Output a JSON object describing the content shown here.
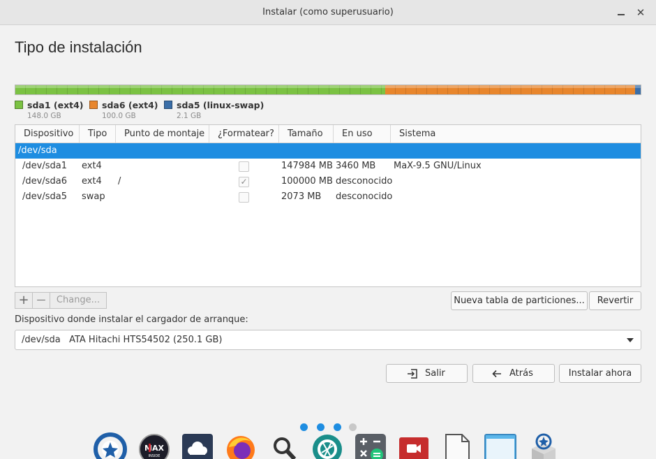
{
  "window": {
    "title": "Instalar (como superusuario)"
  },
  "page": {
    "title": "Tipo de instalación"
  },
  "partitions_bar": [
    {
      "name": "sda1 (ext4)",
      "size": "148.0 GB",
      "color": "#7bc243",
      "fraction": 0.5916
    },
    {
      "name": "sda6 (ext4)",
      "size": "100.0 GB",
      "color": "#e8862d",
      "fraction": 0.3997
    },
    {
      "name": "sda5 (linux-swap)",
      "size": "2.1 GB",
      "color": "#3a6ea8",
      "fraction": 0.0087
    }
  ],
  "table": {
    "columns": [
      "Dispositivo",
      "Tipo",
      "Punto de montaje",
      "¿Formatear?",
      "Tamaño",
      "En uso",
      "Sistema"
    ],
    "rows": [
      {
        "device": "/dev/sda",
        "type": "",
        "mount": "",
        "format": null,
        "size": "",
        "used": "",
        "system": "",
        "selected": true
      },
      {
        "device": "/dev/sda1",
        "type": "ext4",
        "mount": "",
        "format": false,
        "size": "147984 MB",
        "used": "3460 MB",
        "system": "MaX-9.5 GNU/Linux",
        "selected": false
      },
      {
        "device": "/dev/sda6",
        "type": "ext4",
        "mount": "/",
        "format": true,
        "size": "100000 MB",
        "used": "desconocido",
        "system": "",
        "selected": false
      },
      {
        "device": "/dev/sda5",
        "type": "swap",
        "mount": "",
        "format": false,
        "size": "2073 MB",
        "used": "desconocido",
        "system": "",
        "selected": false
      }
    ]
  },
  "toolbar": {
    "add": "+",
    "remove": "—",
    "change": "Change..."
  },
  "actions": {
    "new_table": "Nueva tabla de particiones...",
    "revert": "Revertir"
  },
  "bootloader": {
    "label": "Dispositivo donde instalar el cargador de arranque:",
    "value": "/dev/sda   ATA Hitachi HTS54502 (250.1 GB)"
  },
  "nav": {
    "quit": "Salir",
    "back": "Atrás",
    "install": "Instalar ahora"
  },
  "progress_dots": {
    "total": 4,
    "active": 3
  },
  "dock": [
    "installer-icon",
    "max-logo-icon",
    "nextcloud-icon",
    "firefox-icon",
    "search-icon",
    "camera-aperture-icon",
    "calculator-icon",
    "video-icon",
    "document-icon",
    "window-icon",
    "installer-box-icon"
  ],
  "colors": {
    "accent": "#1e8de1",
    "dot_active": "#1e8de1",
    "dot_inactive": "#c8c8c8"
  }
}
